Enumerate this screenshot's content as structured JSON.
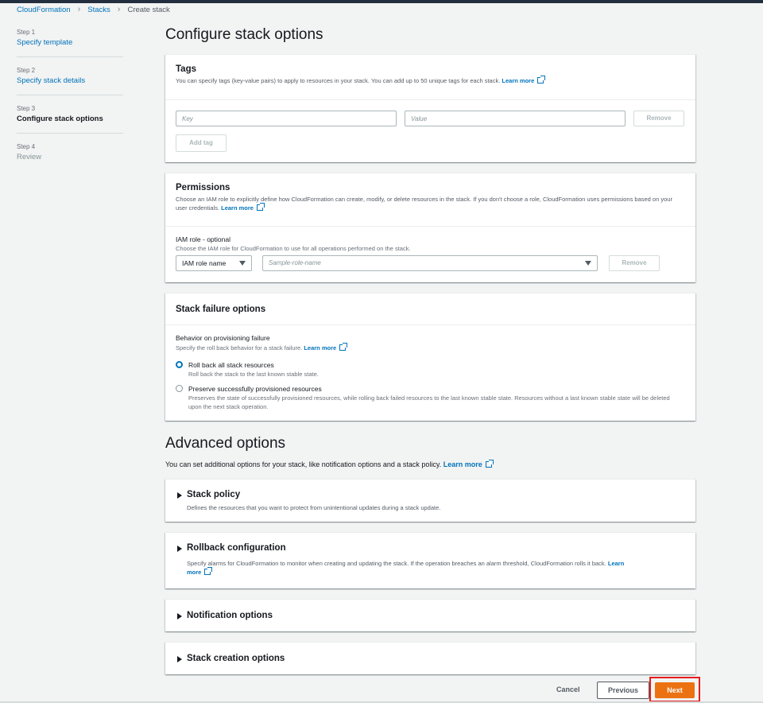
{
  "breadcrumb": {
    "items": [
      "CloudFormation",
      "Stacks",
      "Create stack"
    ]
  },
  "steps": [
    {
      "num": "Step 1",
      "label": "Specify template"
    },
    {
      "num": "Step 2",
      "label": "Specify stack details"
    },
    {
      "num": "Step 3",
      "label": "Configure stack options"
    },
    {
      "num": "Step 4",
      "label": "Review"
    }
  ],
  "page_title": "Configure stack options",
  "tags": {
    "title": "Tags",
    "desc": "You can specify tags (key-value pairs) to apply to resources in your stack. You can add up to 50 unique tags for each stack.",
    "learn_more": "Learn more",
    "key_placeholder": "Key",
    "value_placeholder": "Value",
    "remove": "Remove",
    "add_tag": "Add tag"
  },
  "permissions": {
    "title": "Permissions",
    "desc": "Choose an IAM role to explicitly define how CloudFormation can create, modify, or delete resources in the stack. If you don't choose a role, CloudFormation uses permissions based on your user credentials.",
    "learn_more": "Learn more",
    "iam_label": "IAM role - optional",
    "iam_desc": "Choose the IAM role for CloudFormation to use for all operations performed on the stack.",
    "iam_type": "IAM role name",
    "role_placeholder": "Sample-role-name",
    "remove": "Remove"
  },
  "failure": {
    "title": "Stack failure options",
    "behavior_label": "Behavior on provisioning failure",
    "behavior_desc": "Specify the roll back behavior for a stack failure.",
    "learn_more": "Learn more",
    "options": [
      {
        "label": "Roll back all stack resources",
        "desc": "Roll back the stack to the last known stable state.",
        "checked": true
      },
      {
        "label": "Preserve successfully provisioned resources",
        "desc": "Preserves the state of successfully provisioned resources, while rolling back failed resources to the last known stable state. Resources without a last known stable state will be deleted upon the next stack operation.",
        "checked": false
      }
    ]
  },
  "advanced": {
    "title": "Advanced options",
    "desc": "You can set additional options for your stack, like notification options and a stack policy.",
    "learn_more": "Learn more",
    "sections": [
      {
        "title": "Stack policy",
        "desc": "Defines the resources that you want to protect from unintentional updates during a stack update."
      },
      {
        "title": "Rollback configuration",
        "desc": "Specify alarms for CloudFormation to monitor when creating and updating the stack. If the operation breaches an alarm threshold, CloudFormation rolls it back.",
        "learn_more_a": "Learn",
        "learn_more_b": "more"
      },
      {
        "title": "Notification options"
      },
      {
        "title": "Stack creation options"
      }
    ]
  },
  "footer": {
    "cancel": "Cancel",
    "previous": "Previous",
    "next": "Next"
  },
  "colors": {
    "accent": "#0073bb",
    "primary_button": "#ec7211",
    "highlight_box": "#e81c1c"
  }
}
